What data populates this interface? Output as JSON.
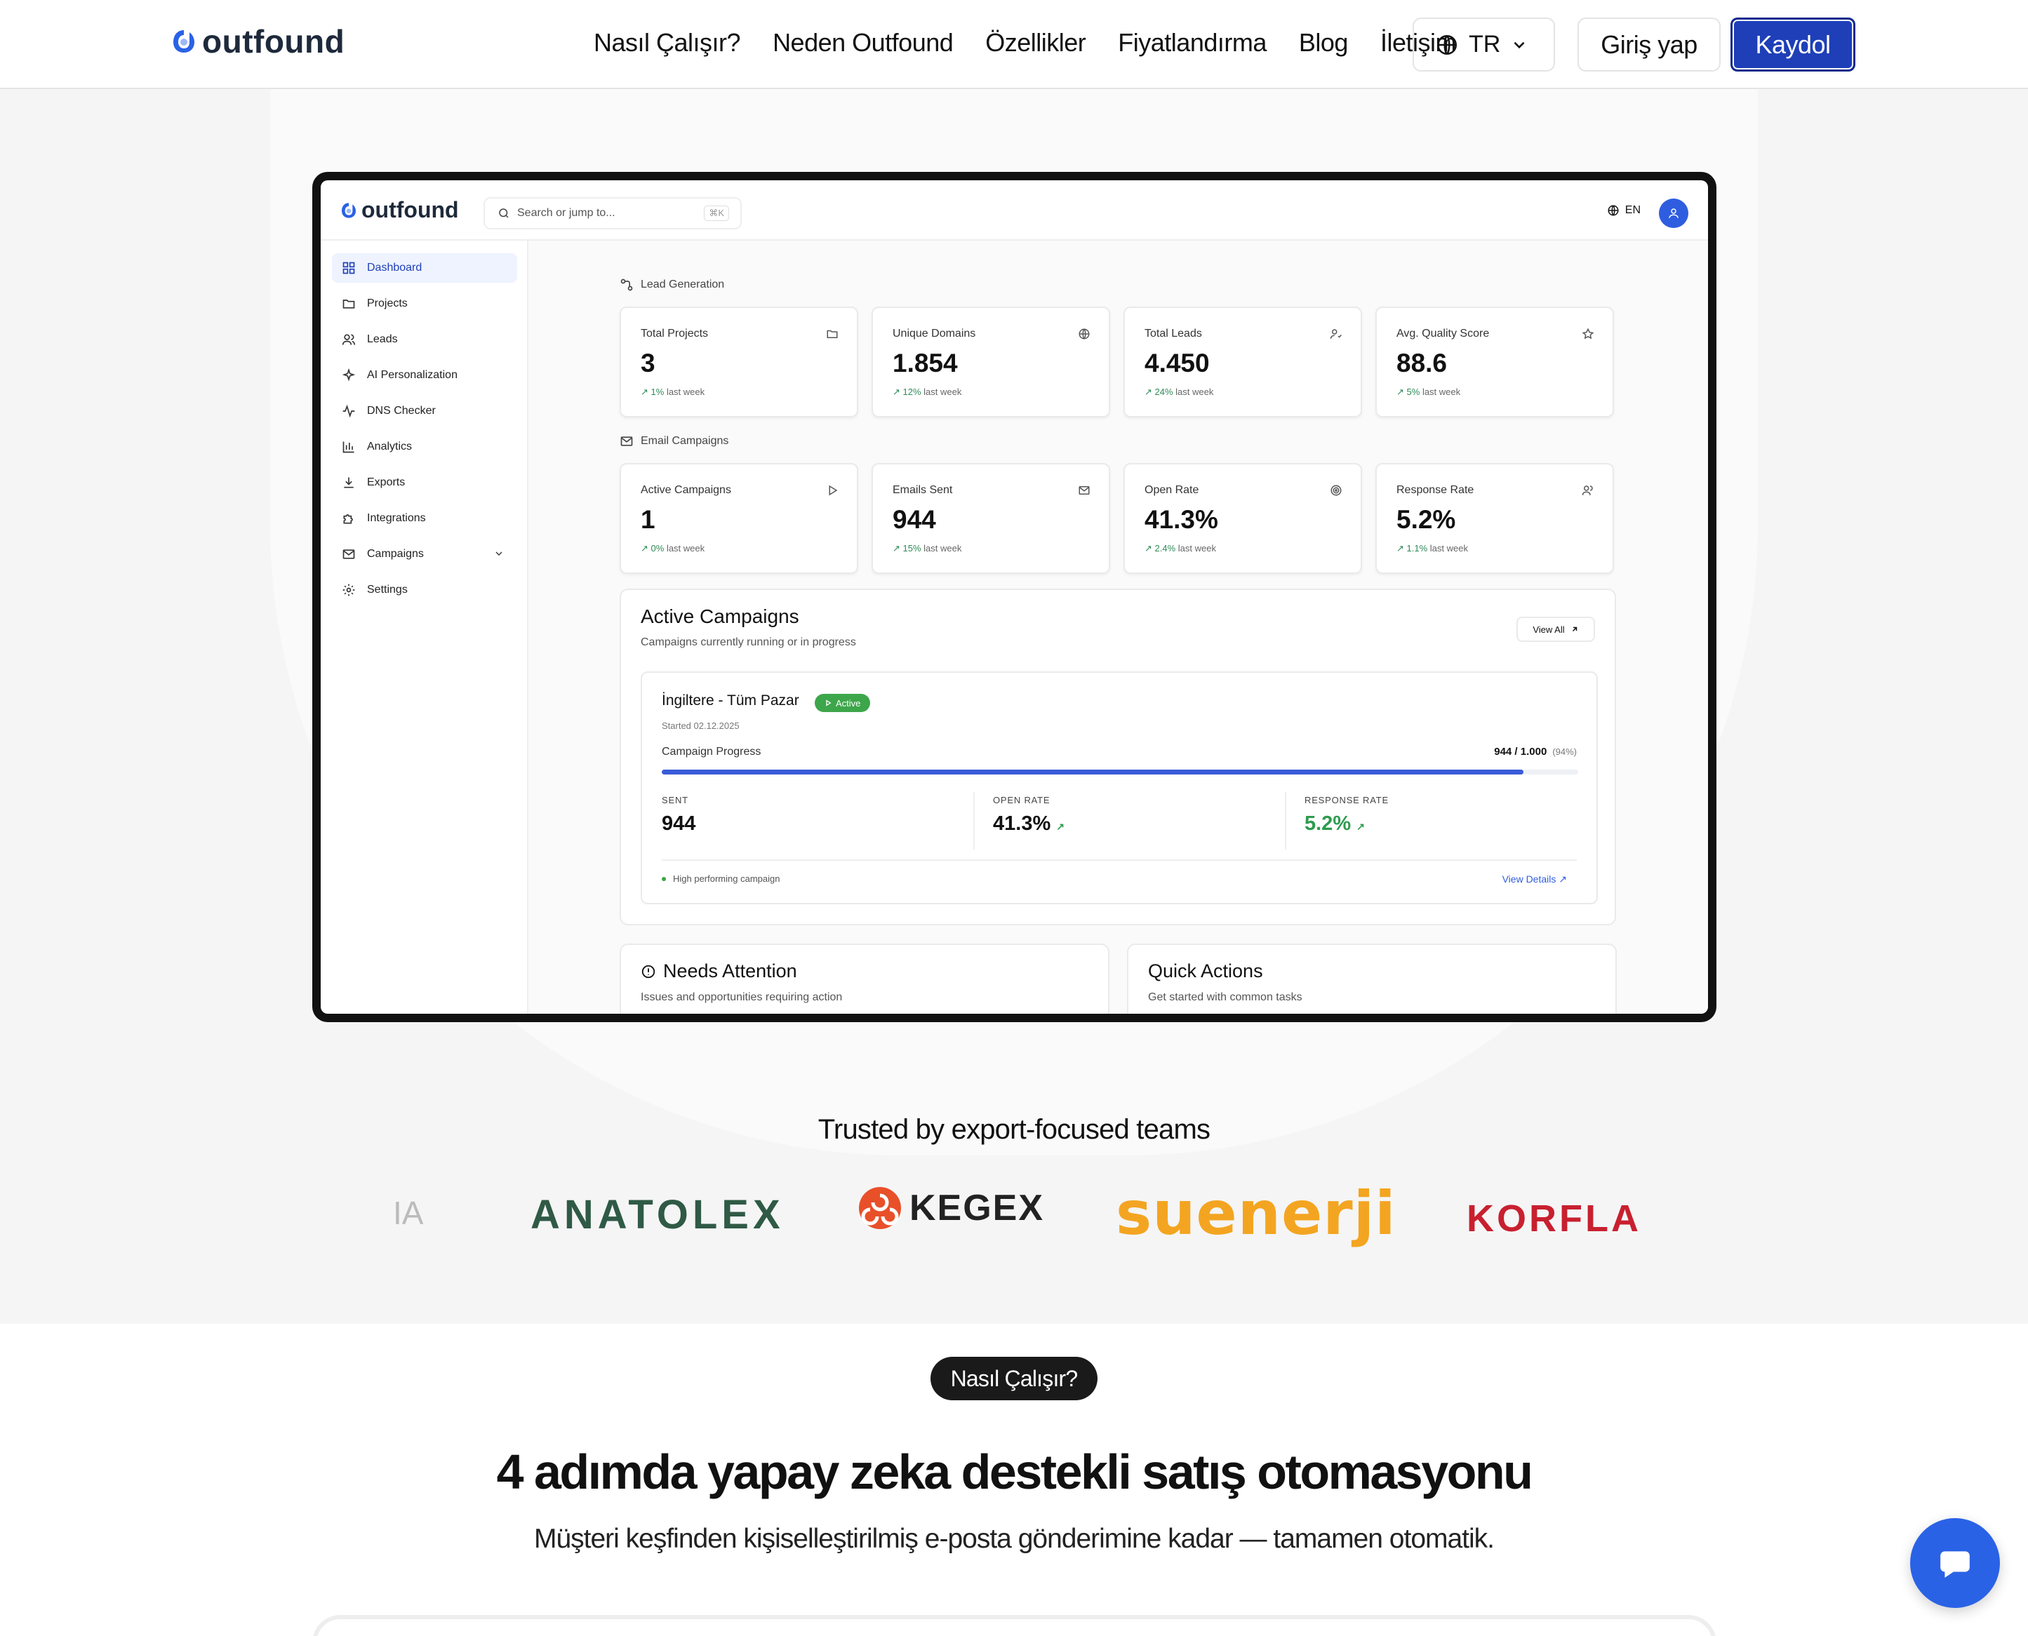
{
  "header": {
    "brand": "outfound",
    "nav": [
      "Nasıl Çalışır?",
      "Neden Outfound",
      "Özellikler",
      "Fiyatlandırma",
      "Blog",
      "İletişim"
    ],
    "language": "TR",
    "login_label": "Giriş yap",
    "signup_label": "Kaydol",
    "brand_color": "#1e3fb8"
  },
  "dashboard": {
    "brand": "outfound",
    "search_placeholder": "Search or jump to...",
    "search_shortcut": "⌘K",
    "language": "EN",
    "sidebar": [
      {
        "label": "Dashboard",
        "icon": "grid-icon",
        "active": true
      },
      {
        "label": "Projects",
        "icon": "folder-icon"
      },
      {
        "label": "Leads",
        "icon": "users-icon"
      },
      {
        "label": "AI Personalization",
        "icon": "sparkles-icon"
      },
      {
        "label": "DNS Checker",
        "icon": "activity-icon"
      },
      {
        "label": "Analytics",
        "icon": "bar-chart-icon"
      },
      {
        "label": "Exports",
        "icon": "download-icon"
      },
      {
        "label": "Integrations",
        "icon": "puzzle-icon"
      },
      {
        "label": "Campaigns",
        "icon": "mail-icon",
        "expandable": true
      },
      {
        "label": "Settings",
        "icon": "gear-icon"
      }
    ],
    "lead_section_label": "Lead Generation",
    "lead_stats": [
      {
        "title": "Total Projects",
        "value": "3",
        "delta": "1%",
        "suffix": "last week",
        "icon": "folder-icon"
      },
      {
        "title": "Unique Domains",
        "value": "1.854",
        "delta": "12%",
        "suffix": "last week",
        "icon": "globe-icon"
      },
      {
        "title": "Total Leads",
        "value": "4.450",
        "delta": "24%",
        "suffix": "last week",
        "icon": "user-check-icon"
      },
      {
        "title": "Avg. Quality Score",
        "value": "88.6",
        "delta": "5%",
        "suffix": "last week",
        "icon": "star-icon"
      }
    ],
    "email_section_label": "Email Campaigns",
    "email_stats": [
      {
        "title": "Active Campaigns",
        "value": "1",
        "delta": "0%",
        "suffix": "last week",
        "icon": "play-icon"
      },
      {
        "title": "Emails Sent",
        "value": "944",
        "delta": "15%",
        "suffix": "last week",
        "icon": "mail-icon"
      },
      {
        "title": "Open Rate",
        "value": "41.3%",
        "delta": "2.4%",
        "suffix": "last week",
        "icon": "target-icon"
      },
      {
        "title": "Response Rate",
        "value": "5.2%",
        "delta": "1.1%",
        "suffix": "last week",
        "icon": "users-icon"
      }
    ],
    "active_campaigns": {
      "title": "Active Campaigns",
      "subtitle": "Campaigns currently running or in progress",
      "view_all": "View All",
      "campaign": {
        "name": "İngiltere - Tüm Pazar",
        "status": "Active",
        "started": "Started 02.12.2025",
        "progress_label": "Campaign Progress",
        "progress_text": "944 / 1.000",
        "progress_pct_text": "(94%)",
        "progress_fraction": 0.94,
        "metrics": [
          {
            "label": "SENT",
            "value": "944"
          },
          {
            "label": "OPEN RATE",
            "value": "41.3%"
          },
          {
            "label": "RESPONSE RATE",
            "value": "5.2%"
          }
        ],
        "note": "High performing campaign",
        "details_link": "View Details"
      }
    },
    "needs_attention": {
      "title": "Needs Attention",
      "subtitle": "Issues and opportunities requiring action"
    },
    "quick_actions": {
      "title": "Quick Actions",
      "subtitle": "Get started with common tasks"
    }
  },
  "trusted": {
    "heading": "Trusted by export-focused teams",
    "logos": [
      "IA",
      "ANATOLEX",
      "KEGEX",
      "suenerji",
      "KORFLA"
    ]
  },
  "how": {
    "pill": "Nasıl Çalışır?",
    "heading": "4 adımda yapay zeka destekli satış otomasyonu",
    "subheading": "Müşteri keşfinden kişiselleştirilmiş e-posta gönderimine kadar — tamamen otomatik."
  }
}
